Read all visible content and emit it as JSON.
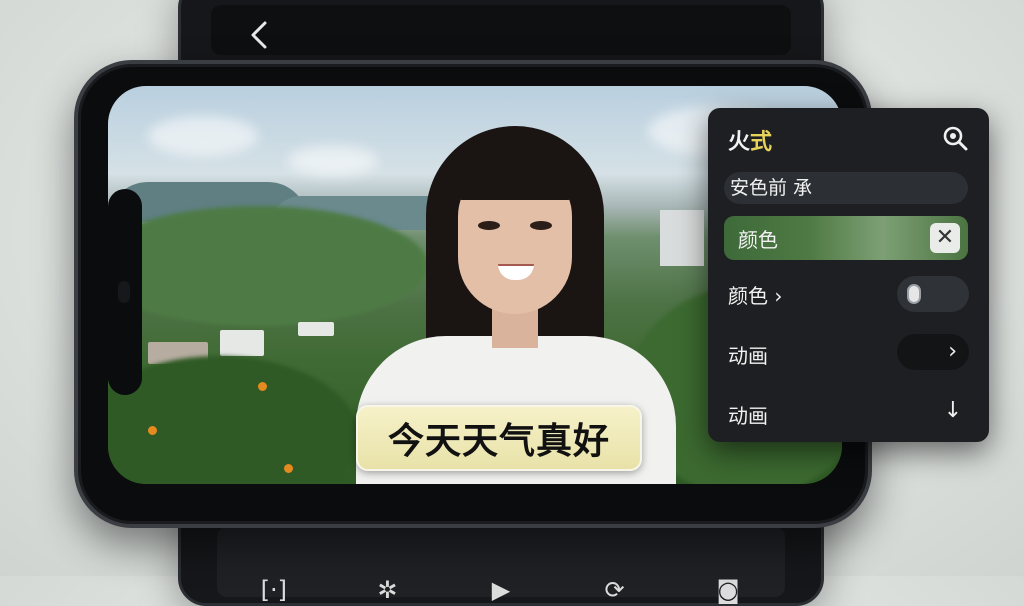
{
  "header": {
    "back_glyph": "‹"
  },
  "video": {
    "subtitle": "今天天气真好"
  },
  "panel": {
    "title_part1": "火",
    "title_part2": "式",
    "search_icon": "search-icon",
    "preset_label": "安色前 承",
    "color_active_label": "颜色",
    "close_glyph": "✕",
    "color_row_label": "颜色 ›",
    "animation_row1_label": "动画",
    "animation_row1_chevron": "›",
    "animation_row2_label": "动画",
    "animation_row2_icon": "↓"
  },
  "bottom_tools": [
    {
      "icon": "crop-icon",
      "glyph": "[·]"
    },
    {
      "icon": "brightness-icon",
      "glyph": "✲"
    },
    {
      "icon": "play-icon",
      "glyph": "▶"
    },
    {
      "icon": "rotate-icon",
      "glyph": "⟳"
    },
    {
      "icon": "camera-icon",
      "glyph": "◙"
    }
  ],
  "colors": {
    "panel_bg": "#1d1f22",
    "title_accent": "#e8d35a",
    "subtitle_bg": "#f6f1c8"
  }
}
